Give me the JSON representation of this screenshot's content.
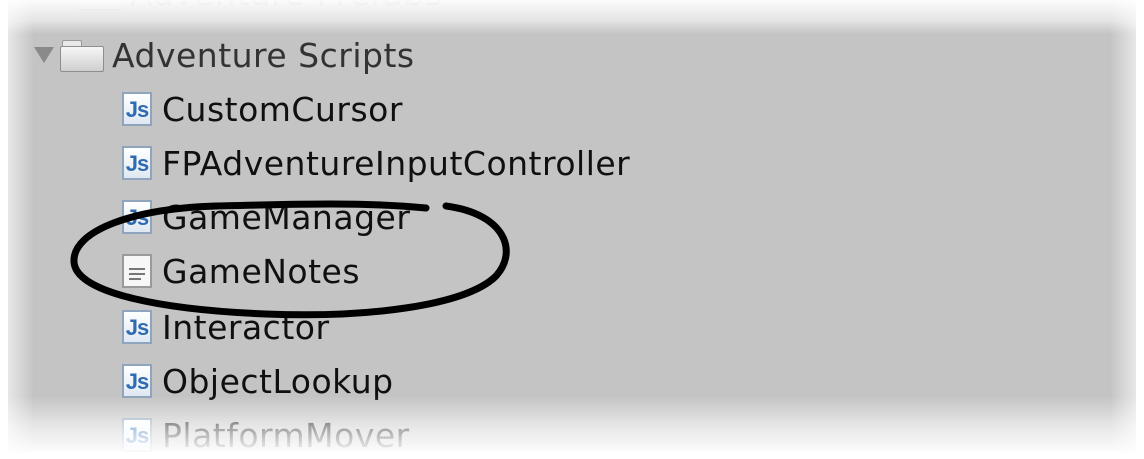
{
  "tree": {
    "partial_top_label": "Adventure Prefabs",
    "folder": {
      "label": "Adventure Scripts",
      "expanded": true,
      "icon": "folder-icon"
    },
    "items": [
      {
        "label": "CustomCursor",
        "icon": "js-icon",
        "icon_text": "Js"
      },
      {
        "label": "FPAdventureInputController",
        "icon": "js-icon",
        "icon_text": "Js"
      },
      {
        "label": "GameManager",
        "icon": "js-icon",
        "icon_text": "Js"
      },
      {
        "label": "GameNotes",
        "icon": "text-file-icon"
      },
      {
        "label": "Interactor",
        "icon": "js-icon",
        "icon_text": "Js"
      },
      {
        "label": "ObjectLookup",
        "icon": "js-icon",
        "icon_text": "Js"
      },
      {
        "label": "PlatformMover",
        "icon": "js-icon",
        "icon_text": "Js"
      }
    ]
  },
  "highlight": {
    "target": "GameNotes",
    "style": "hand-drawn black ellipse"
  },
  "colors": {
    "panel_background": "#c4c4c4",
    "text": "#101010",
    "js_icon_text": "#2f6bb0",
    "annotation": "#000000"
  }
}
